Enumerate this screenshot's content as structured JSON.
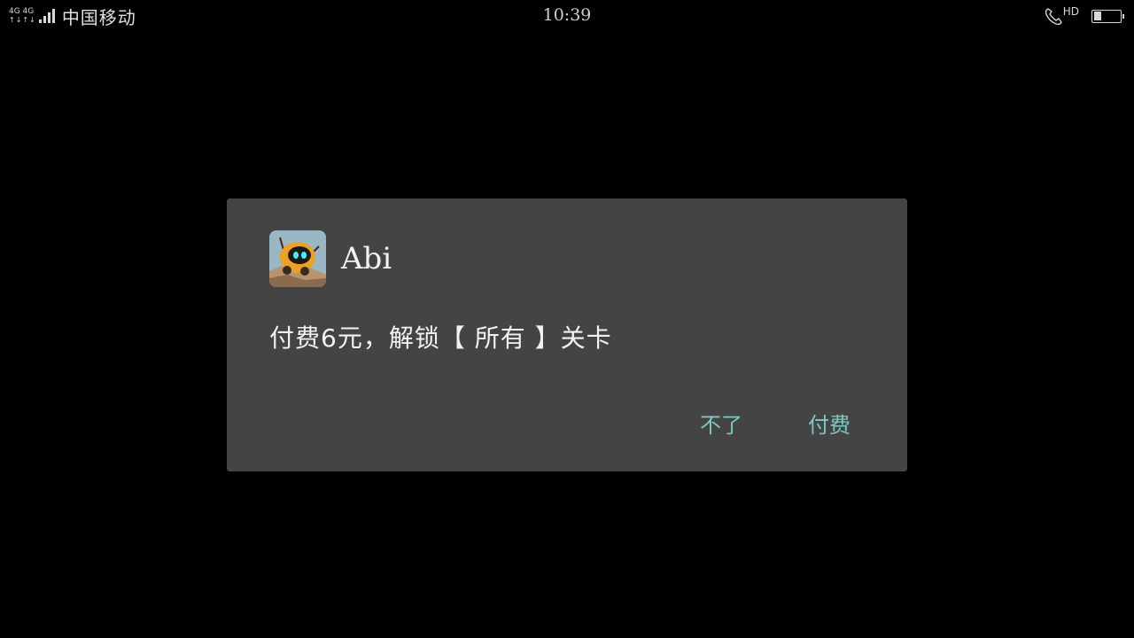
{
  "status_bar": {
    "network_top": "4G 4G",
    "network_arrows": "↑↓↑↓",
    "carrier": "中国移动",
    "time": "10:39",
    "hd_label": "HD",
    "battery_level": 0.3
  },
  "dialog": {
    "app_name": "Abi",
    "app_icon": "robot-game-icon",
    "message": "付费6元，解锁【 所有 】关卡",
    "cancel_label": "不了",
    "confirm_label": "付费"
  },
  "colors": {
    "background": "#000000",
    "dialog_background": "#444444",
    "accent": "#7ec8c2",
    "text": "#f2f2f2"
  }
}
